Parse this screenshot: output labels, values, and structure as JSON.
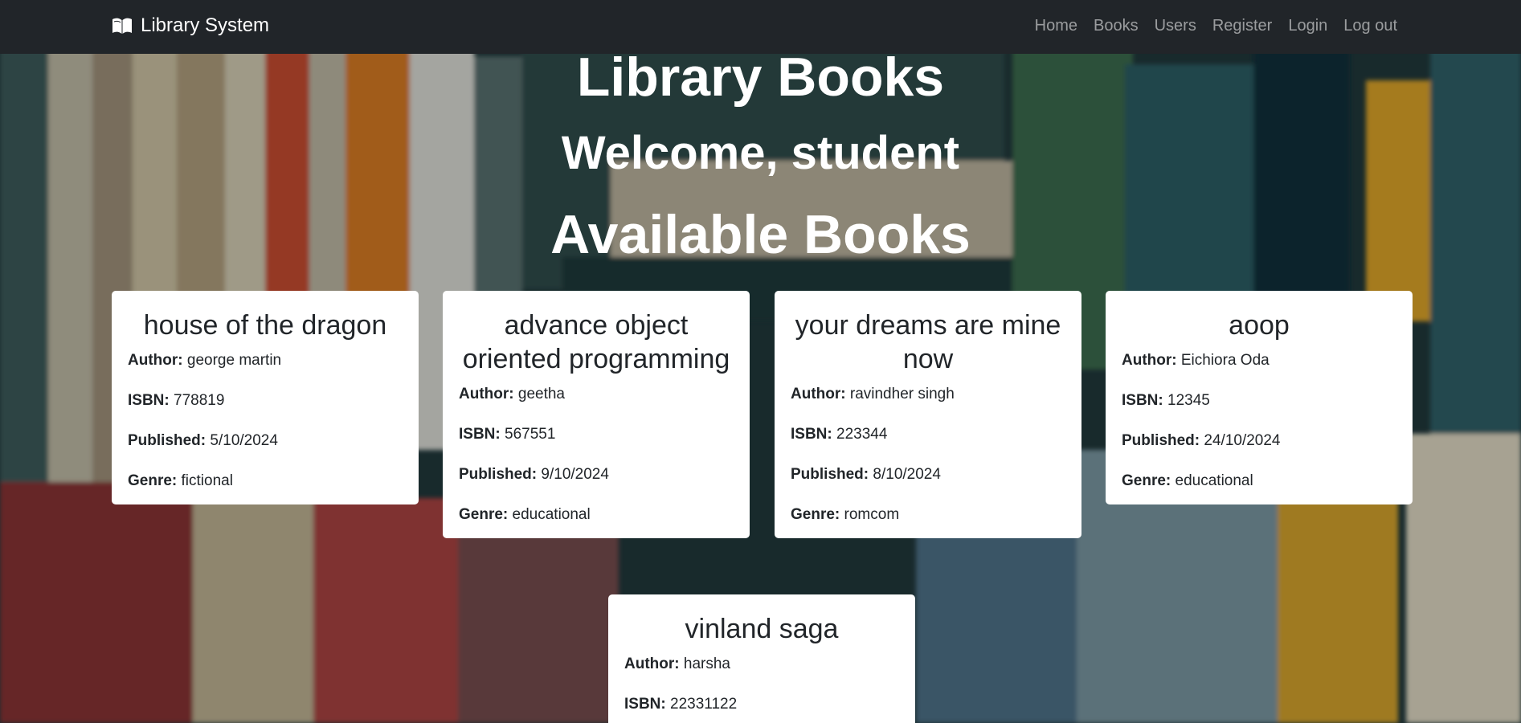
{
  "navbar": {
    "brand": "Library System",
    "brand_icon": "open-book-icon",
    "links": [
      "Home",
      "Books",
      "Users",
      "Register",
      "Login",
      "Log out"
    ]
  },
  "headings": {
    "library": "Library Books",
    "welcome": "Welcome, student",
    "available": "Available Books"
  },
  "labels": {
    "author": "Author:",
    "isbn": "ISBN:",
    "published": "Published:",
    "genre": "Genre:"
  },
  "books": [
    {
      "title": "house of the dragon",
      "author": "george martin",
      "isbn": "778819",
      "published": "5/10/2024",
      "genre": "fictional"
    },
    {
      "title": "advance object oriented programming",
      "author": "geetha",
      "isbn": "567551",
      "published": "9/10/2024",
      "genre": "educational"
    },
    {
      "title": "your dreams are mine now",
      "author": "ravindher singh",
      "isbn": "223344",
      "published": "8/10/2024",
      "genre": "romcom"
    },
    {
      "title": "aoop",
      "author": "Eichiora Oda",
      "isbn": "12345",
      "published": "24/10/2024",
      "genre": "educational"
    },
    {
      "title": "vinland saga",
      "author": "harsha",
      "isbn": "22331122",
      "published": "",
      "genre": ""
    }
  ],
  "colors": {
    "navbar_bg": "#212529",
    "card_bg": "#ffffff",
    "heading_text": "#ffffff"
  }
}
